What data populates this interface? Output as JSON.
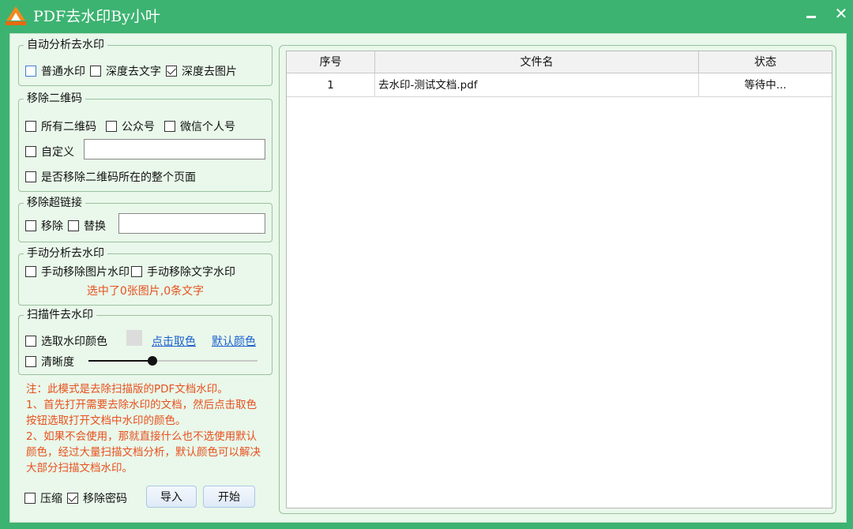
{
  "window": {
    "title": "PDF去水印By小叶",
    "close_glyph": "✕"
  },
  "auto": {
    "title": "自动分析去水印",
    "options": [
      {
        "label": "普通水印",
        "checked": false
      },
      {
        "label": "深度去文字",
        "checked": false
      },
      {
        "label": "深度去图片",
        "checked": true
      }
    ]
  },
  "qr": {
    "title": "移除二维码",
    "options": [
      {
        "label": "所有二维码",
        "checked": false
      },
      {
        "label": "公众号",
        "checked": false
      },
      {
        "label": "微信个人号",
        "checked": false
      }
    ],
    "custom_label": "自定义",
    "custom_value": "",
    "whole_page_label": "是否移除二维码所在的整个页面"
  },
  "link": {
    "title": "移除超链接",
    "remove_label": "移除",
    "replace_label": "替换",
    "replace_value": ""
  },
  "manual": {
    "title": "手动分析去水印",
    "image_label": "手动移除图片水印",
    "text_label": "手动移除文字水印",
    "status": "选中了0张图片,0条文字"
  },
  "scan": {
    "title": "扫描件去水印",
    "color_label": "选取水印颜色",
    "pick_color_link": "点击取色",
    "default_color_link": "默认颜色",
    "clarity_label": "清晰度",
    "clarity_value": 0.38,
    "swatch_color": "#dcdcdc"
  },
  "note": {
    "lines": [
      "注：此模式是去除扫描版的PDF文档水印。",
      "1、首先打开需要去除水印的文档，然后点击取色按钮选取打开文档中水印的颜色。",
      "2、如果不会使用，那就直接什么也不选使用默认颜色，经过大量扫描文档分析，默认颜色可以解决大部分扫描文档水印。"
    ]
  },
  "bottom": {
    "compress_label": "压缩",
    "compress_checked": false,
    "remove_password_label": "移除密码",
    "remove_password_checked": true,
    "import_button": "导入",
    "start_button": "开始"
  },
  "table": {
    "columns": [
      "序号",
      "文件名",
      "状态"
    ],
    "rows": [
      {
        "index": "1",
        "filename": "去水印-测试文档.pdf",
        "status": "等待中..."
      }
    ]
  },
  "colors": {
    "title_bar": "#3cb371",
    "client_bg": "#e9f8ea",
    "warning_text": "#e8501e",
    "link": "#1a5fd0"
  }
}
